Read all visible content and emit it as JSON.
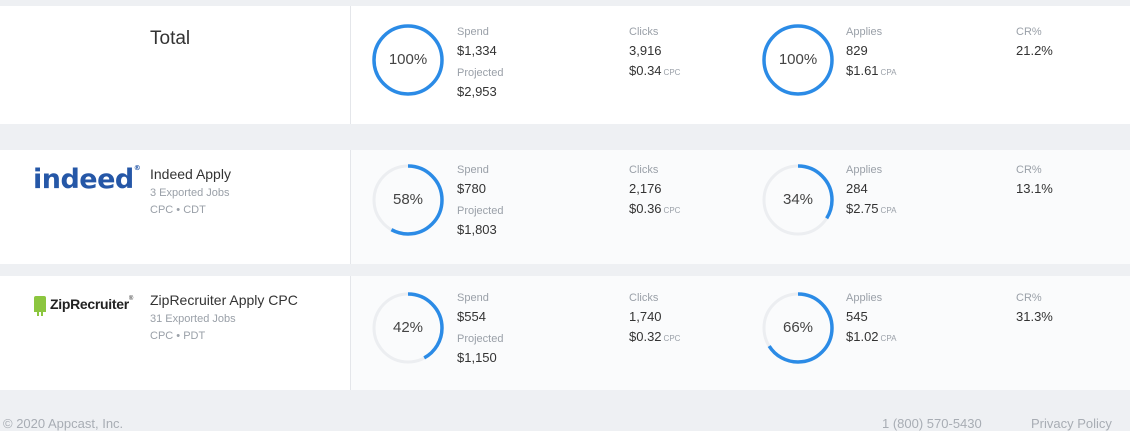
{
  "total": {
    "label": "Total",
    "spend_pct": "100%",
    "spend_pct_value": 1.0,
    "spend_label": "Spend",
    "spend": "$1,334",
    "projected_label": "Projected",
    "projected": "$2,953",
    "clicks_label": "Clicks",
    "clicks": "3,916",
    "cpc": "$0.34",
    "cpc_unit": "CPC",
    "applies_pct": "100%",
    "applies_pct_value": 1.0,
    "applies_label": "Applies",
    "applies": "829",
    "cpa": "$1.61",
    "cpa_unit": "CPA",
    "cr_label": "CR%",
    "cr": "21.2%"
  },
  "sources": [
    {
      "logo_text": "indeed",
      "name": "Indeed Apply",
      "jobs": "3 Exported Jobs",
      "meta": "CPC • CDT",
      "spend_pct": "58%",
      "spend_pct_value": 0.58,
      "spend_label": "Spend",
      "spend": "$780",
      "projected_label": "Projected",
      "projected": "$1,803",
      "clicks_label": "Clicks",
      "clicks": "2,176",
      "cpc": "$0.36",
      "cpc_unit": "CPC",
      "applies_pct": "34%",
      "applies_pct_value": 0.34,
      "applies_label": "Applies",
      "applies": "284",
      "cpa": "$2.75",
      "cpa_unit": "CPA",
      "cr_label": "CR%",
      "cr": "13.1%"
    },
    {
      "logo_text": "ZipRecruiter",
      "name": "ZipRecruiter Apply CPC",
      "jobs": "31 Exported Jobs",
      "meta": "CPC • PDT",
      "spend_pct": "42%",
      "spend_pct_value": 0.42,
      "spend_label": "Spend",
      "spend": "$554",
      "projected_label": "Projected",
      "projected": "$1,150",
      "clicks_label": "Clicks",
      "clicks": "1,740",
      "cpc": "$0.32",
      "cpc_unit": "CPC",
      "applies_pct": "66%",
      "applies_pct_value": 0.66,
      "applies_label": "Applies",
      "applies": "545",
      "cpa": "$1.02",
      "cpa_unit": "CPA",
      "cr_label": "CR%",
      "cr": "31.3%"
    }
  ],
  "footer": {
    "copyright": "© 2020 Appcast, Inc.",
    "phone": "1 (800) 570-5430",
    "privacy": "Privacy Policy"
  },
  "colors": {
    "accent": "#2b8be6",
    "track": "#eceef1"
  }
}
